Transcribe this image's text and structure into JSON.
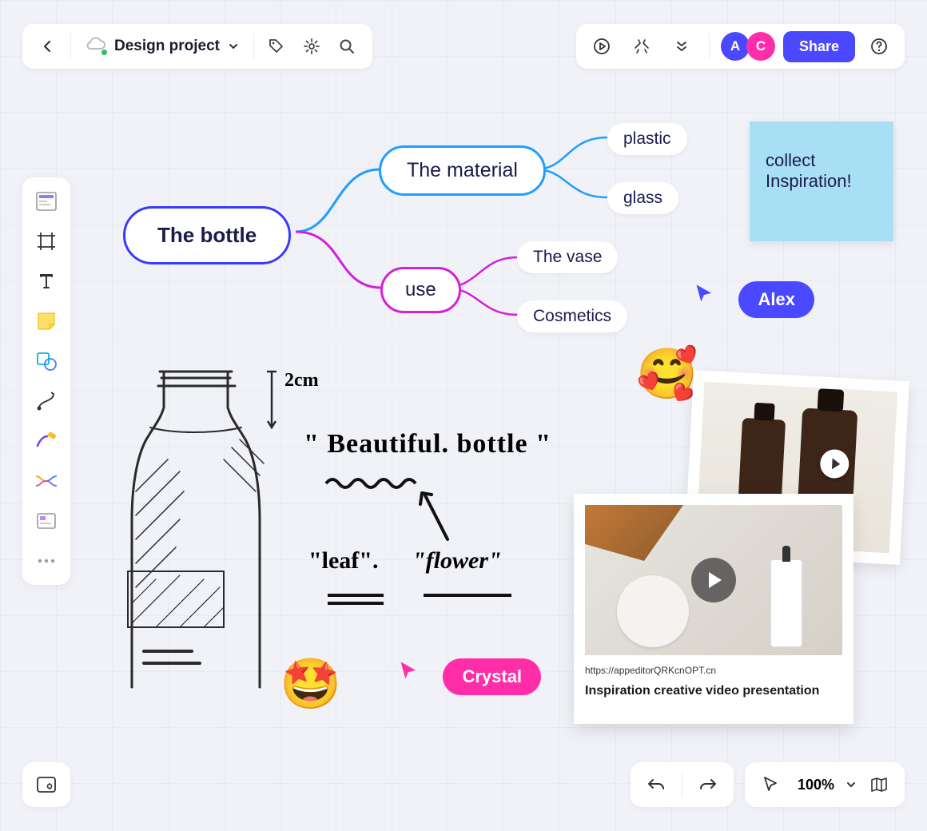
{
  "header": {
    "project_title": "Design project",
    "share_label": "Share",
    "avatars": [
      {
        "initial": "A",
        "color": "#4b49ff"
      },
      {
        "initial": "C",
        "color": "#ff2da8"
      }
    ]
  },
  "mindmap": {
    "root": "The bottle",
    "branch1": {
      "label": "The material",
      "color": "#1f9eff",
      "leaves": [
        "plastic",
        "glass"
      ]
    },
    "branch2": {
      "label": "use",
      "color": "#d321d6",
      "leaves": [
        "The vase",
        "Cosmetics"
      ]
    }
  },
  "sticky_note": "collect Inspiration!",
  "cursors": {
    "alex": {
      "name": "Alex",
      "color": "#4b49ff"
    },
    "crystal": {
      "name": "Crystal",
      "color": "#ff2da8"
    }
  },
  "sketch": {
    "dimension": "2cm",
    "note1": "\" Beautiful. bottle \"",
    "note2_a": "\"leaf\".",
    "note2_b": "\"flower\""
  },
  "card": {
    "url": "https://appeditorQRKcnOPT.cn",
    "title": "Inspiration creative video presentation"
  },
  "footer": {
    "zoom": "100%"
  },
  "colors": {
    "primary": "#4b49ff",
    "accent": "#ff2da8",
    "material_blue": "#1f9eff",
    "use_magenta": "#d321d6",
    "sticky_blue": "#a8dff5"
  }
}
